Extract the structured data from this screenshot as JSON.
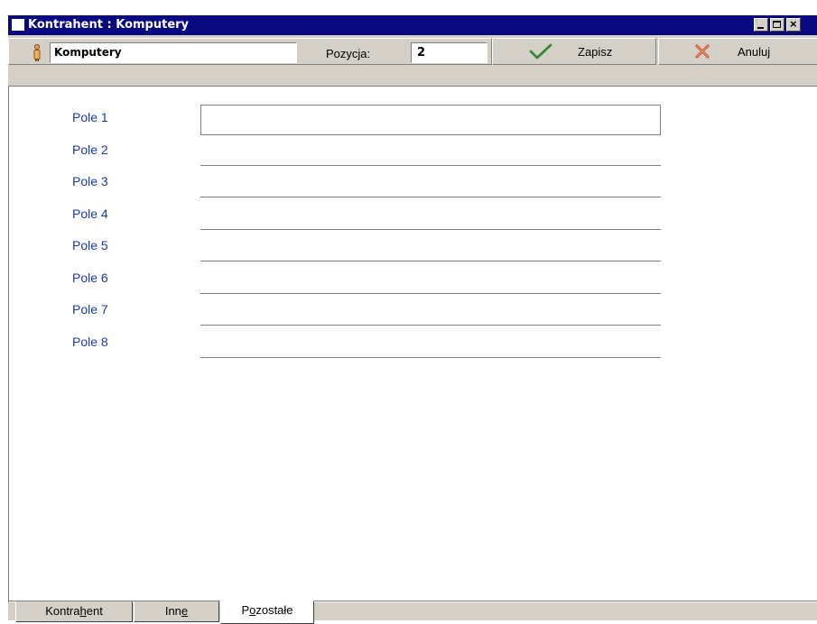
{
  "window": {
    "title": "Kontrahent : Komputery"
  },
  "toolbar": {
    "name_value": "Komputery",
    "position_label": "Pozycja:",
    "position_value": "2",
    "save_label": "Zapisz",
    "cancel_label": "Anuluj"
  },
  "fields": [
    "Pole 1",
    "Pole 2",
    "Pole 3",
    "Pole 4",
    "Pole 5",
    "Pole 6",
    "Pole 7",
    "Pole 8"
  ],
  "tabs": [
    {
      "label": "Kontrahent",
      "accel": "h"
    },
    {
      "label": "Inne",
      "accel": "e"
    },
    {
      "label": "Pozostałe",
      "accel": "o",
      "active": true
    }
  ],
  "colors": {
    "title_bar": "#0a0a80",
    "label": "#1a3ab0",
    "save_check": "#4aa04a",
    "cancel_x": "#d04a20"
  }
}
